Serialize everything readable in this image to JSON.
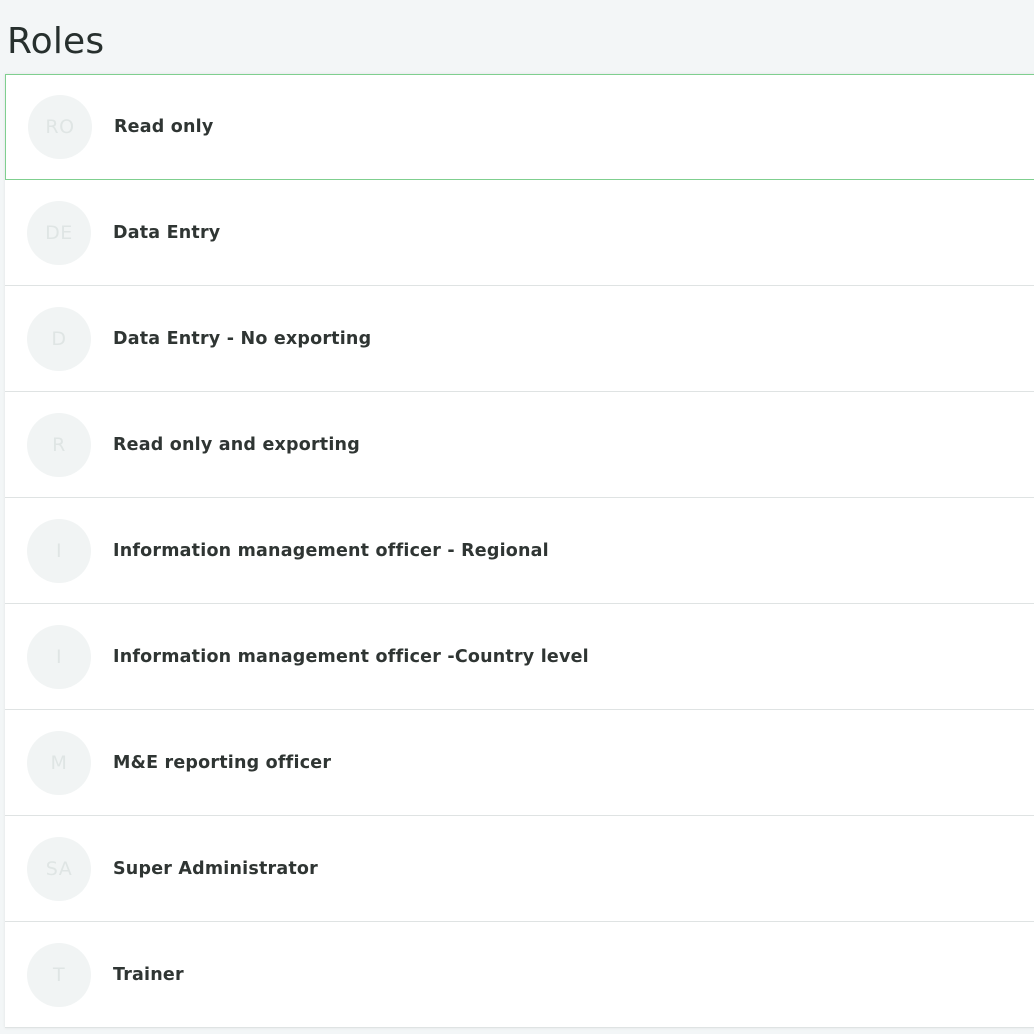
{
  "page": {
    "title": "Roles"
  },
  "colors": {
    "background": "#f3f6f7",
    "selected_border": "#7fcf8f",
    "avatar_bg": "#f1f4f4",
    "avatar_text": "#dfe5e4",
    "text": "#2f3533"
  },
  "roles": [
    {
      "initials": "RO",
      "name": "Read only",
      "selected": true
    },
    {
      "initials": "DE",
      "name": "Data Entry",
      "selected": false
    },
    {
      "initials": "D",
      "name": "Data Entry - No exporting",
      "selected": false
    },
    {
      "initials": "R",
      "name": "Read only and exporting",
      "selected": false
    },
    {
      "initials": "I",
      "name": "Information management officer - Regional",
      "selected": false
    },
    {
      "initials": "I",
      "name": "Information management officer -Country level",
      "selected": false
    },
    {
      "initials": "M",
      "name": "M&E reporting officer",
      "selected": false
    },
    {
      "initials": "SA",
      "name": "Super Administrator",
      "selected": false
    },
    {
      "initials": "T",
      "name": "Trainer",
      "selected": false
    }
  ]
}
